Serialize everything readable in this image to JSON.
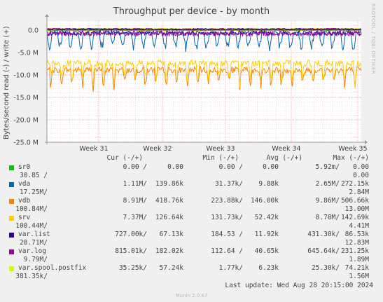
{
  "chart_data": {
    "type": "line",
    "title": "Throughput per device - by month",
    "ylabel": "Bytes/second read (-) / write (+)",
    "ylim": [
      -25000000,
      2000000
    ],
    "yticks": [
      {
        "value": 0,
        "label": "0.0"
      },
      {
        "value": -5000000,
        "label": "-5.0 M"
      },
      {
        "value": -10000000,
        "label": "-10.0 M"
      },
      {
        "value": -15000000,
        "label": "-15.0 M"
      },
      {
        "value": -20000000,
        "label": "-20.0 M"
      },
      {
        "value": -25000000,
        "label": "-25.0 M"
      }
    ],
    "xticks": [
      "Week 31",
      "Week 32",
      "Week 33",
      "Week 34",
      "Week 35"
    ],
    "grid": true,
    "series": [
      {
        "name": "sr0",
        "color": "#00cc00",
        "base": 0,
        "amp": 0,
        "style": "flat"
      },
      {
        "name": "vda",
        "color": "#0066b3",
        "base": -1100000,
        "amp": 3500000,
        "style": "dips"
      },
      {
        "name": "vdb",
        "color": "#ff8000",
        "base": -8900000,
        "amp": 2200000,
        "style": "band"
      },
      {
        "name": "srv",
        "color": "#ffcc00",
        "base": -7400000,
        "amp": 2500000,
        "style": "band"
      },
      {
        "name": "var.list",
        "color": "#330099",
        "base": -700000,
        "amp": 500000,
        "style": "noise"
      },
      {
        "name": "var.log",
        "color": "#990099",
        "base": -800000,
        "amp": 500000,
        "style": "noise"
      },
      {
        "name": "var.spool.postfix",
        "color": "#ccff00",
        "base": 0,
        "amp": 300000,
        "style": "noise"
      }
    ]
  },
  "side_text": "RRDTOOL / TOBI OETIKER",
  "legend": {
    "headers": {
      "cur": "Cur (-/+)",
      "min": "Min (-/+)",
      "avg": "Avg (-/+)",
      "max": "Max (-/+)"
    },
    "rows": [
      {
        "name": "sr0",
        "cur": "0.00 /",
        "cur2": "0.00",
        "min": "0.00 /",
        "min2": "0.00",
        "avg": "5.92m/",
        "avg2": "0.00",
        "max": "30.85 /",
        "max2": "0.00"
      },
      {
        "name": "vda",
        "cur": "1.11M/",
        "cur2": "139.86k",
        "min": "31.37k/",
        "min2": "9.88k",
        "avg": "2.65M/",
        "avg2": "272.15k",
        "max": "17.25M/",
        "max2": "2.84M"
      },
      {
        "name": "vdb",
        "cur": "8.91M/",
        "cur2": "418.76k",
        "min": "223.88k/",
        "min2": "146.00k",
        "avg": "9.86M/",
        "avg2": "506.66k",
        "max": "100.84M/",
        "max2": "13.00M"
      },
      {
        "name": "srv",
        "cur": "7.37M/",
        "cur2": "126.64k",
        "min": "131.73k/",
        "min2": "52.42k",
        "avg": "8.78M/",
        "avg2": "142.69k",
        "max": "100.44M/",
        "max2": "4.41M"
      },
      {
        "name": "var.list",
        "cur": "727.00k/",
        "cur2": "67.13k",
        "min": "184.53 /",
        "min2": "11.92k",
        "avg": "431.30k/",
        "avg2": "86.53k",
        "max": "28.71M/",
        "max2": "12.83M"
      },
      {
        "name": "var.log",
        "cur": "815.01k/",
        "cur2": "182.02k",
        "min": "112.64 /",
        "min2": "40.65k",
        "avg": "645.64k/",
        "avg2": "231.25k",
        "max": "9.79M/",
        "max2": "1.89M"
      },
      {
        "name": "var.spool.postfix",
        "cur": "35.25k/",
        "cur2": "57.24k",
        "min": "1.77k/",
        "min2": "6.23k",
        "avg": "25.30k/",
        "avg2": "74.21k",
        "max": "381.35k/",
        "max2": "1.56M"
      }
    ]
  },
  "last_update": "Last update: Wed Aug 28 20:15:00 2024",
  "footer": "Munin 2.0.67"
}
